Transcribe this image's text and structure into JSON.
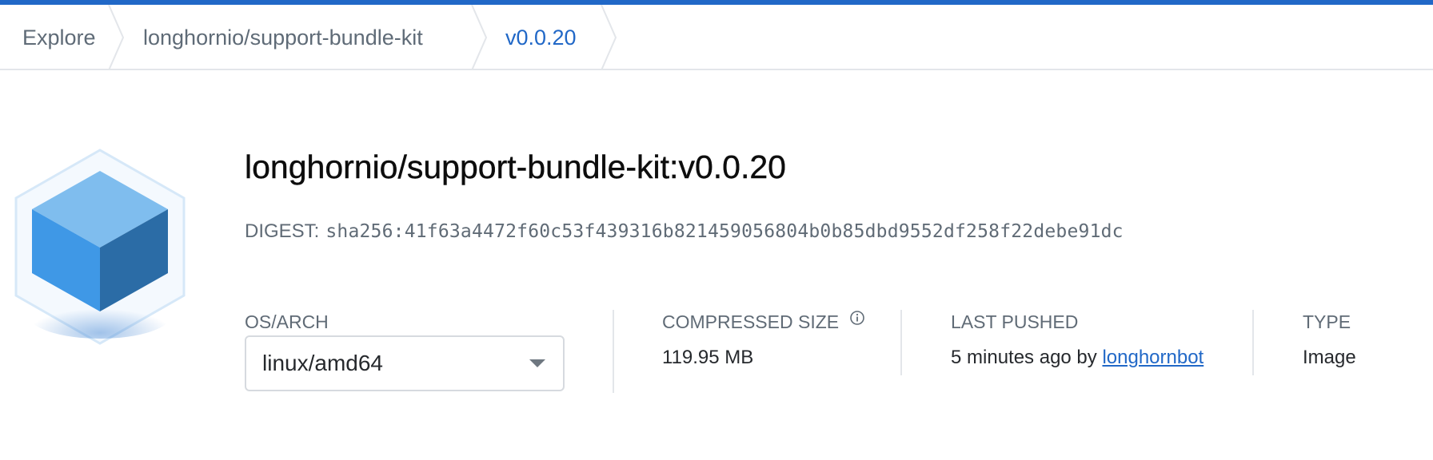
{
  "colors": {
    "accent": "#2168c7",
    "text_muted": "#606b76",
    "text_primary": "#0d0d0d",
    "divider": "#e3e6ea"
  },
  "breadcrumb": {
    "items": [
      {
        "label": "Explore",
        "icon": "chevron-right-icon"
      },
      {
        "label": "longhornio/support-bundle-kit",
        "icon": "chevron-right-icon"
      },
      {
        "label": "v0.0.20",
        "icon": "chevron-right-icon",
        "active": true
      }
    ]
  },
  "image": {
    "logo_icon": "cube-icon",
    "title": "longhornio/support-bundle-kit:v0.0.20",
    "digest_label": "DIGEST:",
    "digest_value": "sha256:41f63a4472f60c53f439316b821459056804b0b85dbd9552df258f22debe91dc"
  },
  "details": {
    "os_arch": {
      "label": "OS/ARCH",
      "selected": "linux/amd64",
      "icon": "caret-down-icon"
    },
    "compressed_size": {
      "label": "COMPRESSED SIZE",
      "value": "119.95 MB",
      "icon": "info-icon"
    },
    "last_pushed": {
      "label": "LAST PUSHED",
      "value_prefix": "5 minutes ago by",
      "user": "longhornbot"
    },
    "type": {
      "label": "TYPE",
      "value": "Image"
    }
  }
}
